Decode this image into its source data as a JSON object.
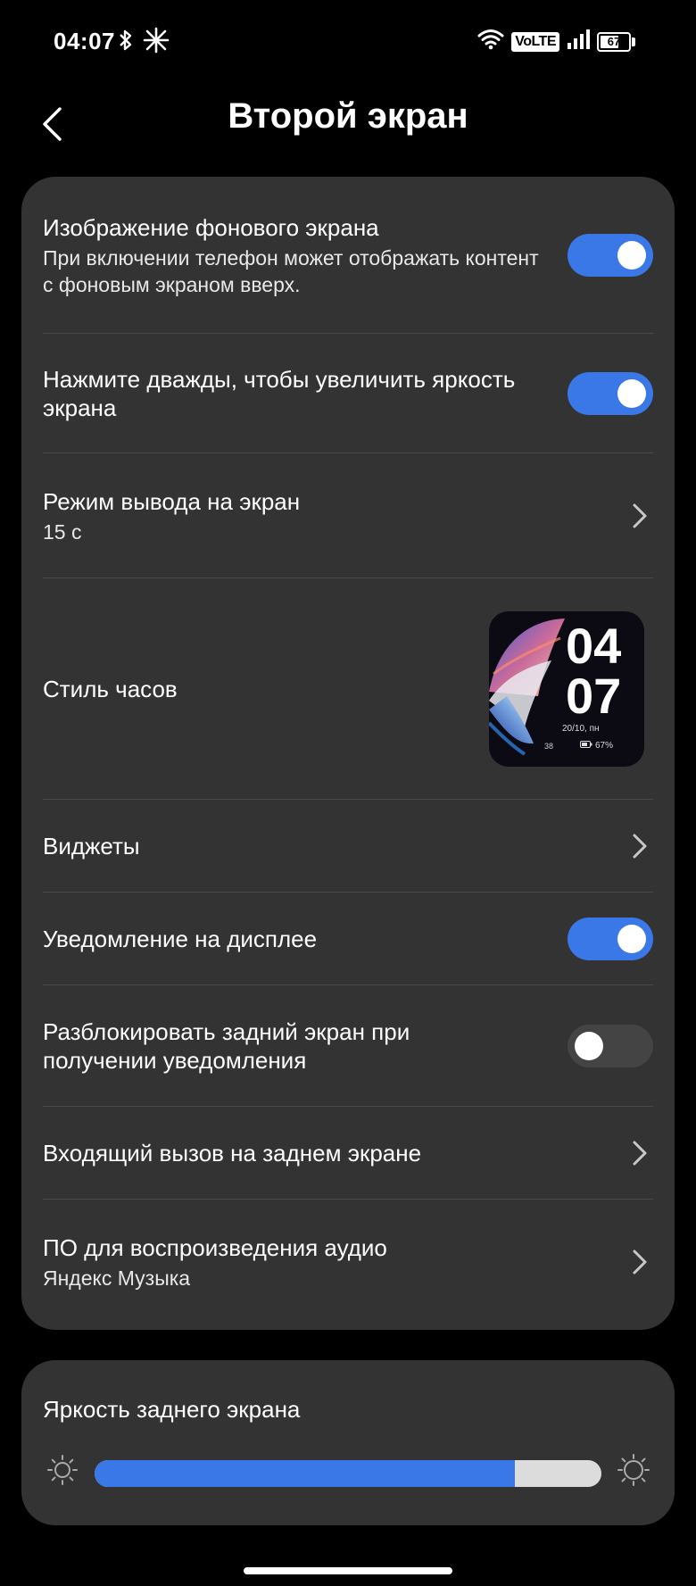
{
  "status": {
    "time": "04:07",
    "network": "VoLTE",
    "battery": "67",
    "battery_level": 0.67
  },
  "header": {
    "title": "Второй экран"
  },
  "settings": {
    "background_image": {
      "title": "Изображение фонового экрана",
      "subtitle": "При включении телефон может отображать контент с фоновым экраном вверх.",
      "enabled": true
    },
    "double_tap": {
      "title": "Нажмите дважды, чтобы увеличить яркость экрана",
      "enabled": true
    },
    "display_mode": {
      "title": "Режим вывода на экран",
      "value": "15 с"
    },
    "clock_style": {
      "title": "Стиль часов",
      "preview": {
        "hours": "04",
        "minutes": "07",
        "date": "20/10,  пн",
        "steps": "38",
        "battery": "67%"
      }
    },
    "widgets": {
      "title": "Виджеты"
    },
    "notification_display": {
      "title": "Уведомление на дисплее",
      "enabled": true
    },
    "unlock_rear": {
      "title": "Разблокировать задний экран при получении уведомления",
      "enabled": false
    },
    "incoming_call": {
      "title": "Входящий вызов на заднем экране"
    },
    "audio_app": {
      "title": "ПО для воспроизведения аудио",
      "value": "Яндекс Музыка"
    }
  },
  "brightness": {
    "title": "Яркость заднего экрана",
    "level": 0.83
  },
  "colors": {
    "accent": "#3a78e8",
    "card": "#333333",
    "background": "#000000"
  }
}
